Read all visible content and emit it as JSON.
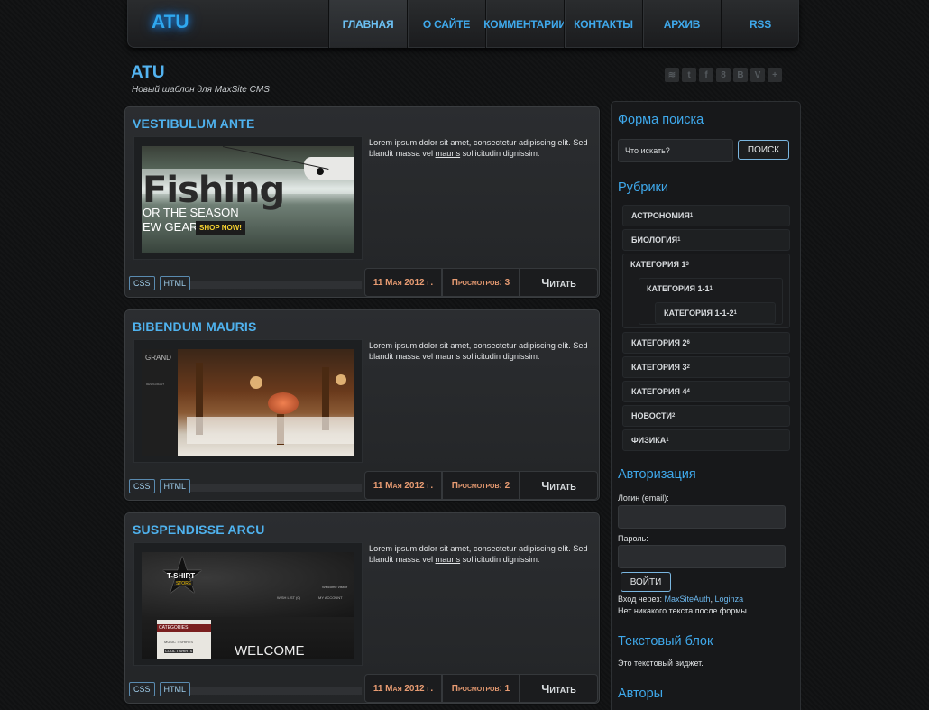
{
  "header": {
    "logo": "ATU",
    "nav": [
      {
        "label": "Главная"
      },
      {
        "label": "О сайте"
      },
      {
        "label": "Комментарии"
      },
      {
        "label": "Контакты"
      },
      {
        "label": "Архив"
      },
      {
        "label": "RSS"
      }
    ]
  },
  "site": {
    "title": "ATU",
    "subtitle": "Новый шаблон для MaxSite CMS",
    "social": [
      "rss",
      "twitter",
      "facebook",
      "odnoklassniki",
      "vkontakte",
      "vimeo",
      "plus"
    ]
  },
  "posts": [
    {
      "title": "Vestibulum ante",
      "text_before": "Lorem ipsum dolor sit amet, consectetur adipiscing elit. Sed blandit massa vel ",
      "link": "mauris",
      "text_after": " sollicitudin dignissim.",
      "image": {
        "line1": "Fishing",
        "line2": "OR THE SEASON",
        "line3": "EW GEAR!",
        "cta": "SHOP NOW!"
      },
      "tags": [
        "CSS",
        "HTML"
      ],
      "date": "11 Мая 2012 г.",
      "views": "Просмотров: 3",
      "read": "Читать"
    },
    {
      "title": "Bibendum mauris",
      "text_before": "Lorem ipsum dolor sit amet, consectetur adipiscing elit. Sed blandit massa vel mauris sollicitudin dignissim.",
      "link": "",
      "text_after": "",
      "image": {
        "line1": "GRAND",
        "line2": "RESTAURANT"
      },
      "tags": [
        "CSS",
        "HTML"
      ],
      "date": "11 Мая 2012 г.",
      "views": "Просмотров: 2",
      "read": "Читать"
    },
    {
      "title": "Suspendisse arcu",
      "text_before": "Lorem ipsum dolor sit amet, consectetur adipiscing elit. Sed blandit massa vel ",
      "link": "mauris",
      "text_after": " sollicitudin dignissim.",
      "image": {
        "badge1": "T-SHIRT",
        "badge2": "STORE",
        "welcome_top": "Welcome visitor",
        "wish": "WISH LIST (0)",
        "account": "MY ACCOUNT",
        "categories": "CATEGORIES",
        "cat1": "MUSIC T SHIRTS",
        "cat2": "COOL T SHIRTS",
        "welcome": "WELCOME"
      },
      "tags": [
        "CSS",
        "HTML"
      ],
      "date": "11 Мая 2012 г.",
      "views": "Просмотров: 1",
      "read": "Читать"
    }
  ],
  "sidebar": {
    "search": {
      "title": "Форма поиска",
      "placeholder": "Что искать?",
      "button": "Поиск"
    },
    "categories": {
      "title": "Рубрики",
      "items": [
        {
          "name": "Астрономия",
          "count": "1"
        },
        {
          "name": "Биология",
          "count": "1"
        },
        {
          "name": "Категория 1",
          "count": "3"
        },
        {
          "name": "Категория 1-1",
          "count": "1"
        },
        {
          "name": "Категория 1-1-2",
          "count": "1"
        },
        {
          "name": "Категория 2",
          "count": "6"
        },
        {
          "name": "Категория 3",
          "count": "2"
        },
        {
          "name": "Категория 4",
          "count": "4"
        },
        {
          "name": "Новости",
          "count": "2"
        },
        {
          "name": "Физика",
          "count": "1"
        }
      ]
    },
    "auth": {
      "title": "Авторизация",
      "login_label": "Логин (email):",
      "password_label": "Пароль:",
      "button": "Войти",
      "via_label": "Вход через: ",
      "via_link1": "MaxSiteAuth",
      "via_sep": ", ",
      "via_link2": "Loginza",
      "note": "Нет никакого текста после формы"
    },
    "text_block": {
      "title": "Текстовый блок",
      "text": "Это текстовый виджет."
    },
    "authors": {
      "title": "Авторы"
    }
  }
}
